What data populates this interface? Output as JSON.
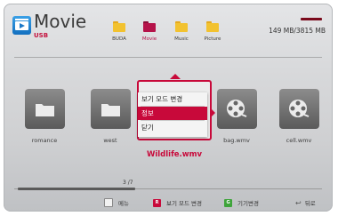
{
  "header": {
    "title": "Movie",
    "subtitle": "USB",
    "storage": "149 MB/3815 MB"
  },
  "folder_tabs": [
    {
      "label": "BUDA",
      "color": "#f2c230",
      "active": false
    },
    {
      "label": "Movie",
      "color": "#b5134a",
      "active": true
    },
    {
      "label": "Music",
      "color": "#f2c230",
      "active": false
    },
    {
      "label": "Picture",
      "color": "#f2c230",
      "active": false
    }
  ],
  "files": [
    {
      "label": "romance",
      "icon": "folder-icon"
    },
    {
      "label": "west",
      "icon": "folder-icon"
    },
    {
      "label": "Wildlife.wmv",
      "icon": "film-reel-icon",
      "selected": true
    },
    {
      "label": "bag.wmv",
      "icon": "film-reel-icon"
    },
    {
      "label": "cell.wmv",
      "icon": "film-reel-icon"
    }
  ],
  "context_menu": {
    "items": [
      "보기 모드 변경",
      "정보",
      "닫기"
    ],
    "selected_index": 1
  },
  "pager": {
    "text": "3 /7",
    "position": 3,
    "total": 7
  },
  "footer": {
    "menu_label": "메뉴",
    "red_key": "R",
    "red_label": "보기 모드 변경",
    "green_key": "G",
    "green_label": "기기변경",
    "back_label": "뒤로"
  },
  "colors": {
    "accent": "#c8093a",
    "red_key": "#c8093a",
    "green_key": "#3ea43a",
    "folder": "#f2c230"
  }
}
